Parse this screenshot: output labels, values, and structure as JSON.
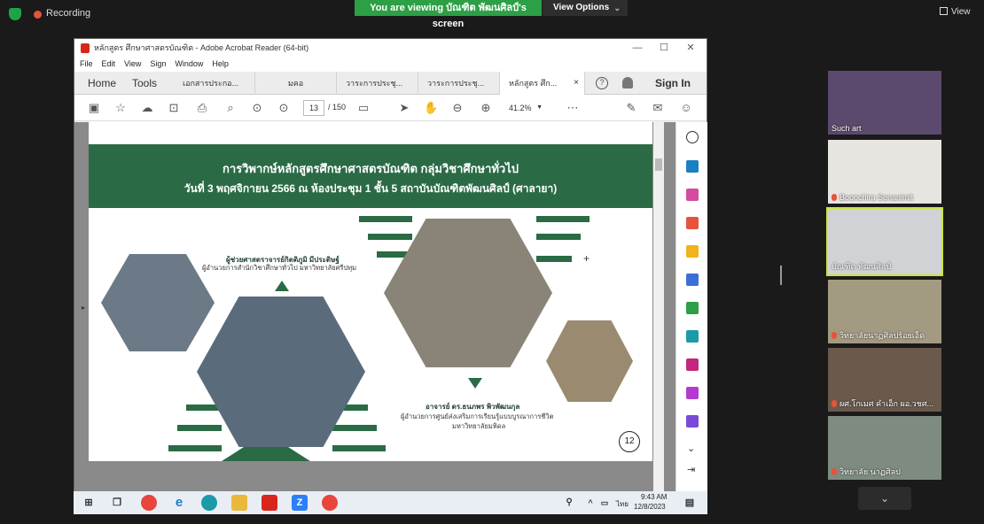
{
  "zoom": {
    "recording_label": "Recording",
    "viewing_banner": "You are viewing บัณฑิต พัฒนศิลป์'s screen",
    "view_options_label": "View Options",
    "view_label": "View",
    "colors": {
      "banner": "#2d9f45",
      "active_tile": "#c8e63a",
      "record": "#e5533c"
    }
  },
  "acrobat": {
    "window_title": "หลักสูตร ศึกษาศาสตรบัณฑิต - Adobe Acrobat Reader (64-bit)",
    "menu": [
      "File",
      "Edit",
      "View",
      "Sign",
      "Window",
      "Help"
    ],
    "home_label": "Home",
    "tools_label": "Tools",
    "tabs": [
      "เอกสารประกอ...",
      "มคอ",
      "วาระการประชุ...",
      "วาระการประชุ...",
      "หลักสูตร ศึก..."
    ],
    "sign_in_label": "Sign In",
    "current_page": "13",
    "total_pages": "/ 150",
    "zoom_level": "41.2%",
    "accent": "#d9261c"
  },
  "slide": {
    "title": "การวิพากษ์หลักสูตรศึกษาศาสตรบัณฑิต กลุ่มวิชาศึกษาทั่วไป",
    "subtitle": "วันที่ 3 พฤศจิกายน 2566 ณ ห้องประชุม 1 ชั้น 5 สถาบันบัณฑิตพัฒนศิลป์ (ศาลายา)",
    "person1_name": "ผู้ช่วยศาสตราจารย์กิตติภูมิ มีประดิษฐ์",
    "person1_role": "ผู้อำนวยการสำนักวิชาศึกษาทั่วไป มหาวิทยาลัยศรีปทุม",
    "person2_name": "อาจารย์ ดร.ธนภพร พิวพัฒนกุล",
    "person2_role_line1": "ผู้อำนวยการศูนย์ส่งเสริมการเรียนรู้แบบบูรณาการชีวิต",
    "person2_role_line2": "มหาวิทยาลัยมหิดล",
    "page_number": "12",
    "theme_color": "#2a6b45"
  },
  "participants": [
    {
      "name": "Such art",
      "muted": false
    },
    {
      "name": "Boonchira Senanimit",
      "muted": true
    },
    {
      "name": "บัณฑิต พัฒนศิลป์",
      "muted": false
    },
    {
      "name": "วิทยาลัยนาฏศิลปร้อยเอ็ด",
      "muted": true
    },
    {
      "name": "ผศ.โกเมศ คำเอ็ก ผอ.วชศ...",
      "muted": true
    },
    {
      "name": "วิทยาลัย นาฏศิลป",
      "muted": true
    }
  ],
  "taskbar": {
    "time": "9:43 AM",
    "date": "12/8/2023",
    "language": "ไทย"
  }
}
